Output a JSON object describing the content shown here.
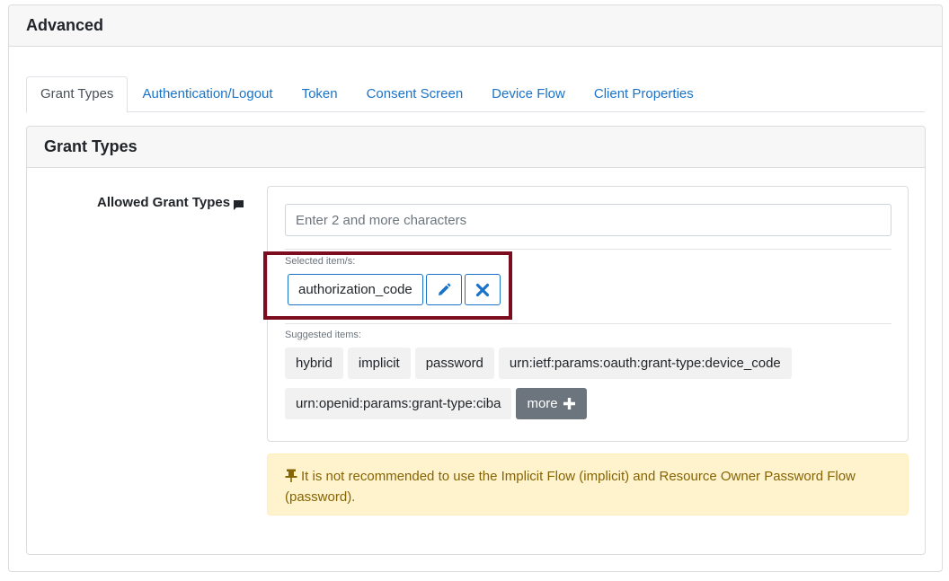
{
  "section": {
    "title": "Advanced"
  },
  "tabs": [
    {
      "label": "Grant Types",
      "active": true
    },
    {
      "label": "Authentication/Logout",
      "active": false
    },
    {
      "label": "Token",
      "active": false
    },
    {
      "label": "Consent Screen",
      "active": false
    },
    {
      "label": "Device Flow",
      "active": false
    },
    {
      "label": "Client Properties",
      "active": false
    }
  ],
  "grant_types": {
    "title": "Grant Types",
    "field_label": "Allowed Grant Types",
    "search": {
      "placeholder": "Enter 2 and more characters",
      "value": ""
    },
    "selected_caption": "Selected item/s:",
    "selected_items": [
      "authorization_code"
    ],
    "suggested_caption": "Suggested items:",
    "suggested_items": [
      "hybrid",
      "implicit",
      "password",
      "urn:ietf:params:oauth:grant-type:device_code",
      "urn:openid:params:grant-type:ciba"
    ],
    "more_label": "more",
    "warning": "It is not recommended to use the Implicit Flow (implicit) and Resource Owner Password Flow (password)."
  },
  "icons": {
    "label_info": "comment-icon",
    "edit": "pencil-icon",
    "remove": "close-icon",
    "more": "plus-icon",
    "warning": "pin-icon"
  },
  "colors": {
    "link": "#1a73c9",
    "highlight_border": "#7b0d1e",
    "warning_bg": "#fff3cd",
    "warning_text": "#856404",
    "more_bg": "#6c757d"
  }
}
